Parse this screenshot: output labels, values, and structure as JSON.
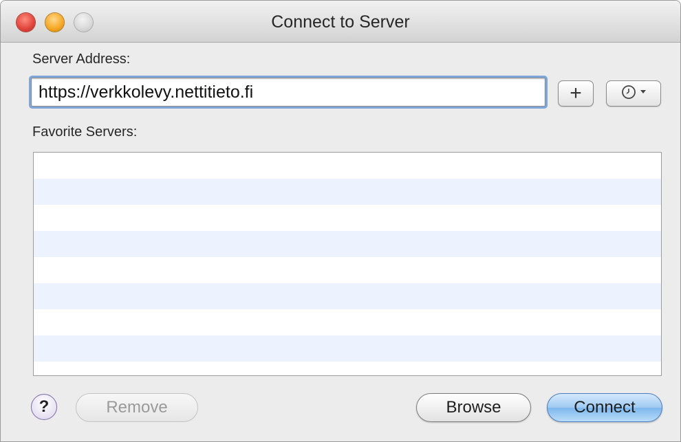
{
  "window": {
    "title": "Connect to Server",
    "controls": [
      "close",
      "minimize",
      "zoom"
    ]
  },
  "server_address": {
    "label": "Server Address:",
    "value": "https://verkkolevy.nettitieto.fi",
    "add_button_symbol": "+",
    "add_button_icon": "plus-icon",
    "recent_button_icon": "clock-icon"
  },
  "favorites": {
    "label": "Favorite Servers:",
    "items": []
  },
  "footer": {
    "help_symbol": "?",
    "remove_label": "Remove",
    "browse_label": "Browse",
    "connect_label": "Connect"
  },
  "colors": {
    "accent": "#7db6ec",
    "focus_ring": "#7fa6d9",
    "list_stripe": "#edf3fe",
    "close": "#e0443a",
    "minimize": "#f5a623"
  }
}
